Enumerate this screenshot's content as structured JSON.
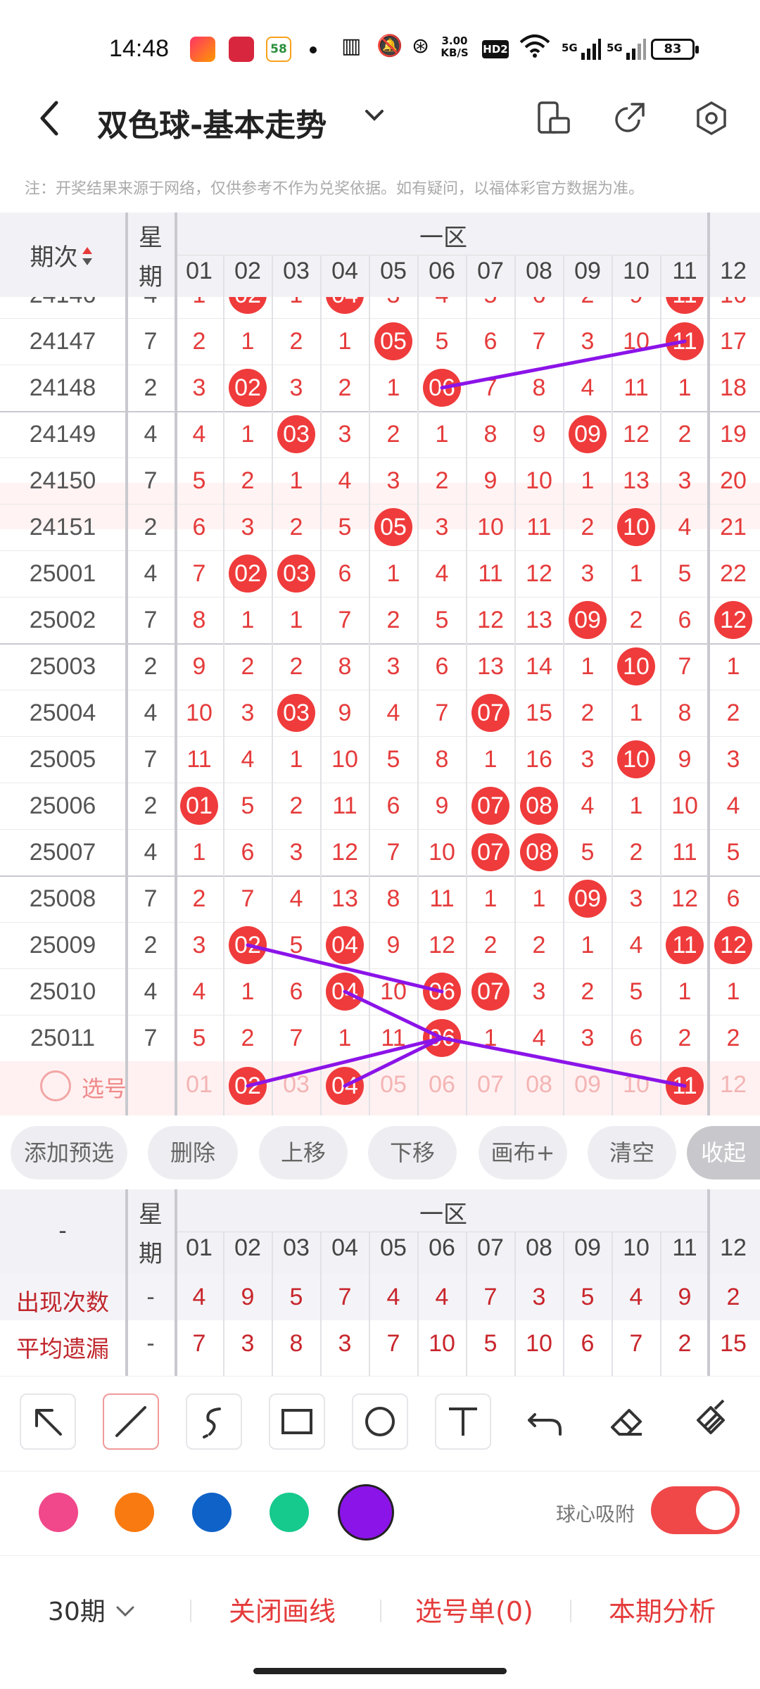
{
  "status_bar": {
    "time": "14:48",
    "net_speed_value": "3.00",
    "net_speed_unit": "KB/S",
    "hd": "HD2",
    "signal1": "5G",
    "signal2": "5G",
    "battery": "83",
    "app3_label": "58"
  },
  "header": {
    "title": "双色球-基本走势",
    "back_icon": "back-arrow-icon",
    "dropdown_icon": "chevron-down-icon",
    "icons": [
      "phone-rotate-icon",
      "share-icon",
      "settings-icon"
    ]
  },
  "notice": "注：开奖结果来源于网络，仅供参考不作为兑奖依据。如有疑问，以福体彩官方数据为准。",
  "trend": {
    "period_header": "期次",
    "week_header": "星期",
    "week_header_l1": "星",
    "week_header_l2": "期",
    "zone_label": "一区",
    "columns": [
      "01",
      "02",
      "03",
      "04",
      "05",
      "06",
      "07",
      "08",
      "09",
      "10",
      "11",
      "12"
    ],
    "partial_row": {
      "period": "24146",
      "week": "4",
      "cells": [
        "1",
        "02",
        "1",
        "04",
        "3",
        "4",
        "5",
        "6",
        "2",
        "9",
        "11",
        "16"
      ],
      "balls": [
        1,
        3,
        10
      ]
    },
    "rows": [
      {
        "period": "24147",
        "week": "7",
        "cells": [
          "2",
          "1",
          "2",
          "1",
          "05",
          "5",
          "6",
          "7",
          "3",
          "10",
          "11",
          "17"
        ],
        "balls": [
          4,
          10
        ]
      },
      {
        "period": "24148",
        "week": "2",
        "cells": [
          "3",
          "02",
          "3",
          "2",
          "1",
          "06",
          "7",
          "8",
          "4",
          "11",
          "1",
          "18"
        ],
        "balls": [
          1,
          5
        ]
      },
      {
        "period": "24149",
        "week": "4",
        "cells": [
          "4",
          "1",
          "03",
          "3",
          "2",
          "1",
          "8",
          "9",
          "09",
          "12",
          "2",
          "19"
        ],
        "balls": [
          2,
          8
        ]
      },
      {
        "period": "24150",
        "week": "7",
        "cells": [
          "5",
          "2",
          "1",
          "4",
          "3",
          "2",
          "9",
          "10",
          "1",
          "13",
          "3",
          "20"
        ],
        "balls": []
      },
      {
        "period": "24151",
        "week": "2",
        "cells": [
          "6",
          "3",
          "2",
          "5",
          "05",
          "3",
          "10",
          "11",
          "2",
          "10",
          "4",
          "21"
        ],
        "balls": [
          4,
          9
        ]
      },
      {
        "period": "25001",
        "week": "4",
        "cells": [
          "7",
          "02",
          "03",
          "6",
          "1",
          "4",
          "11",
          "12",
          "3",
          "1",
          "5",
          "22"
        ],
        "balls": [
          1,
          2
        ]
      },
      {
        "period": "25002",
        "week": "7",
        "cells": [
          "8",
          "1",
          "1",
          "7",
          "2",
          "5",
          "12",
          "13",
          "09",
          "2",
          "6",
          "12"
        ],
        "balls": [
          8,
          11
        ]
      },
      {
        "period": "25003",
        "week": "2",
        "cells": [
          "9",
          "2",
          "2",
          "8",
          "3",
          "6",
          "13",
          "14",
          "1",
          "10",
          "7",
          "1"
        ],
        "balls": [
          9
        ]
      },
      {
        "period": "25004",
        "week": "4",
        "cells": [
          "10",
          "3",
          "03",
          "9",
          "4",
          "7",
          "07",
          "15",
          "2",
          "1",
          "8",
          "2"
        ],
        "balls": [
          2,
          6
        ]
      },
      {
        "period": "25005",
        "week": "7",
        "cells": [
          "11",
          "4",
          "1",
          "10",
          "5",
          "8",
          "1",
          "16",
          "3",
          "10",
          "9",
          "3"
        ],
        "balls": [
          9
        ]
      },
      {
        "period": "25006",
        "week": "2",
        "cells": [
          "01",
          "5",
          "2",
          "11",
          "6",
          "9",
          "07",
          "08",
          "4",
          "1",
          "10",
          "4"
        ],
        "balls": [
          0,
          6,
          7
        ]
      },
      {
        "period": "25007",
        "week": "4",
        "cells": [
          "1",
          "6",
          "3",
          "12",
          "7",
          "10",
          "07",
          "08",
          "5",
          "2",
          "11",
          "5"
        ],
        "balls": [
          6,
          7
        ]
      },
      {
        "period": "25008",
        "week": "7",
        "cells": [
          "2",
          "7",
          "4",
          "13",
          "8",
          "11",
          "1",
          "1",
          "09",
          "3",
          "12",
          "6"
        ],
        "balls": [
          8
        ]
      },
      {
        "period": "25009",
        "week": "2",
        "cells": [
          "3",
          "02",
          "5",
          "04",
          "9",
          "12",
          "2",
          "2",
          "1",
          "4",
          "11",
          "12"
        ],
        "balls": [
          1,
          3,
          10,
          11
        ]
      },
      {
        "period": "25010",
        "week": "4",
        "cells": [
          "4",
          "1",
          "6",
          "04",
          "10",
          "06",
          "07",
          "3",
          "2",
          "5",
          "1",
          "1"
        ],
        "balls": [
          3,
          5,
          6
        ]
      },
      {
        "period": "25011",
        "week": "7",
        "cells": [
          "5",
          "2",
          "7",
          "1",
          "11",
          "06",
          "1",
          "4",
          "3",
          "6",
          "2",
          "2"
        ],
        "balls": [
          5
        ]
      }
    ],
    "select_row": {
      "label": "选号",
      "cells": [
        "01",
        "02",
        "03",
        "04",
        "05",
        "06",
        "07",
        "08",
        "09",
        "10",
        "11",
        "12"
      ],
      "balls": [
        1,
        3,
        10
      ]
    }
  },
  "actions": [
    "添加预选",
    "删除",
    "上移",
    "下移",
    "画布+",
    "清空",
    "收起"
  ],
  "stats": {
    "left_header": "-",
    "week_header_l1": "星",
    "week_header_l2": "期",
    "zone_label": "一区",
    "columns": [
      "01",
      "02",
      "03",
      "04",
      "05",
      "06",
      "07",
      "08",
      "09",
      "10",
      "11",
      "12"
    ],
    "rows": [
      {
        "label": "出现次数",
        "week": "-",
        "values": [
          "4",
          "9",
          "5",
          "7",
          "4",
          "4",
          "7",
          "3",
          "5",
          "4",
          "9",
          "2"
        ]
      },
      {
        "label": "平均遗漏",
        "week": "-",
        "values": [
          "7",
          "3",
          "8",
          "3",
          "7",
          "10",
          "5",
          "10",
          "6",
          "7",
          "2",
          "15"
        ]
      }
    ]
  },
  "tools": [
    "arrow-tool-icon",
    "line-tool-icon",
    "freehand-tool-icon",
    "rectangle-tool-icon",
    "circle-tool-icon",
    "text-tool-icon",
    "undo-icon",
    "eraser-icon",
    "clear-brush-icon"
  ],
  "colors": {
    "swatches": [
      "#f0488a",
      "#f97a10",
      "#0f62c8",
      "#16c98c",
      "#8b14e8"
    ],
    "selected": "#8b14e8",
    "line_color": "#8b14e8",
    "ball_color": "#ef3b3b",
    "accent": "#e53b3b"
  },
  "snap_label": "球心吸附",
  "snap_enabled": true,
  "bottom": {
    "period": "30期",
    "close_lines": "关闭画线",
    "selection": "选号单(0)",
    "analysis": "本期分析"
  }
}
